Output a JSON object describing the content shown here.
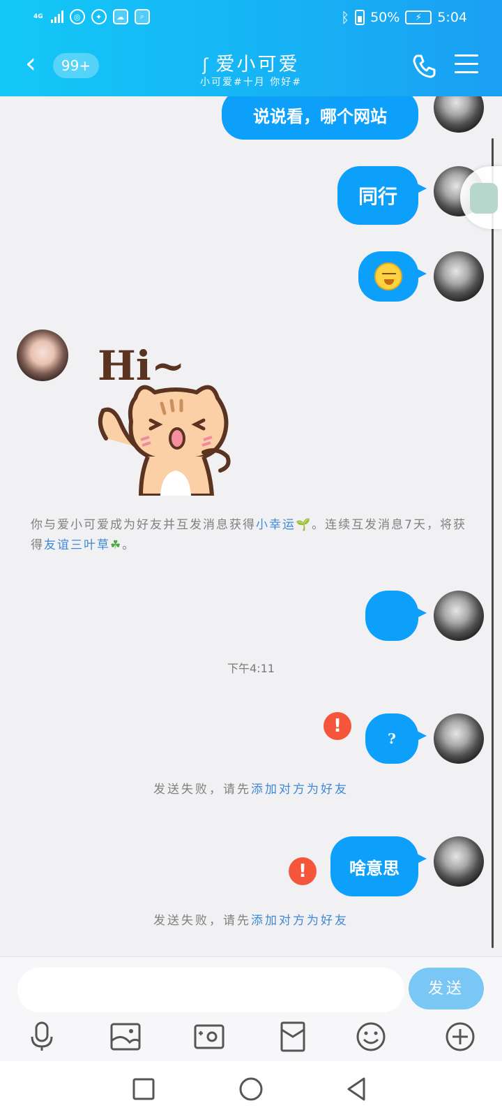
{
  "status_bar": {
    "network": "4G",
    "battery_percent": "50%",
    "time": "5:04",
    "icons": [
      "signal-icon",
      "netease-music-icon",
      "browser-icon",
      "cloud-icon",
      "search-icon",
      "bluetooth-icon",
      "battery-icon",
      "charging-icon"
    ]
  },
  "header": {
    "back_icon": "chevron-left-icon",
    "unread_badge": "99+",
    "contact_name": "爱小可爱",
    "contact_icon": "ear-icon",
    "subtitle": "小可爱#十月 你好#",
    "call_icon": "phone-icon",
    "menu_icon": "menu-icon"
  },
  "messages": {
    "m1_text": "说说看，哪个网站",
    "m2_text": "同行",
    "m3_emoji": "sneeze-emoji",
    "m4_sticker": "hi-cat-sticker",
    "m4_sticker_text": "Hi~",
    "m5_text": "",
    "m6_text": "?",
    "m7_text": "啥意思"
  },
  "notice": {
    "part1": "你与爱小可爱成为好友并互发消息获得",
    "link1": "小幸运",
    "part2": "。连续互发消息7天，将获得",
    "link2": "友谊三叶草",
    "part3": "。"
  },
  "timestamp": "下午4:11",
  "fail_notice": {
    "prefix": "发送失败，请先",
    "link": "添加对方为好友"
  },
  "composer": {
    "placeholder": "",
    "send_label": "发送",
    "tools": [
      "microphone-icon",
      "image-icon",
      "camera-icon",
      "red-packet-icon",
      "emoji-icon",
      "plus-icon"
    ]
  },
  "nav": [
    "recent-apps-icon",
    "home-icon",
    "back-icon"
  ],
  "colors": {
    "header_start": "#13c8f7",
    "header_end": "#1a9ff3",
    "bubble": "#0da0fa",
    "link": "#3f88d8",
    "error": "#f4553b",
    "send_button": "#7ac6f5"
  }
}
